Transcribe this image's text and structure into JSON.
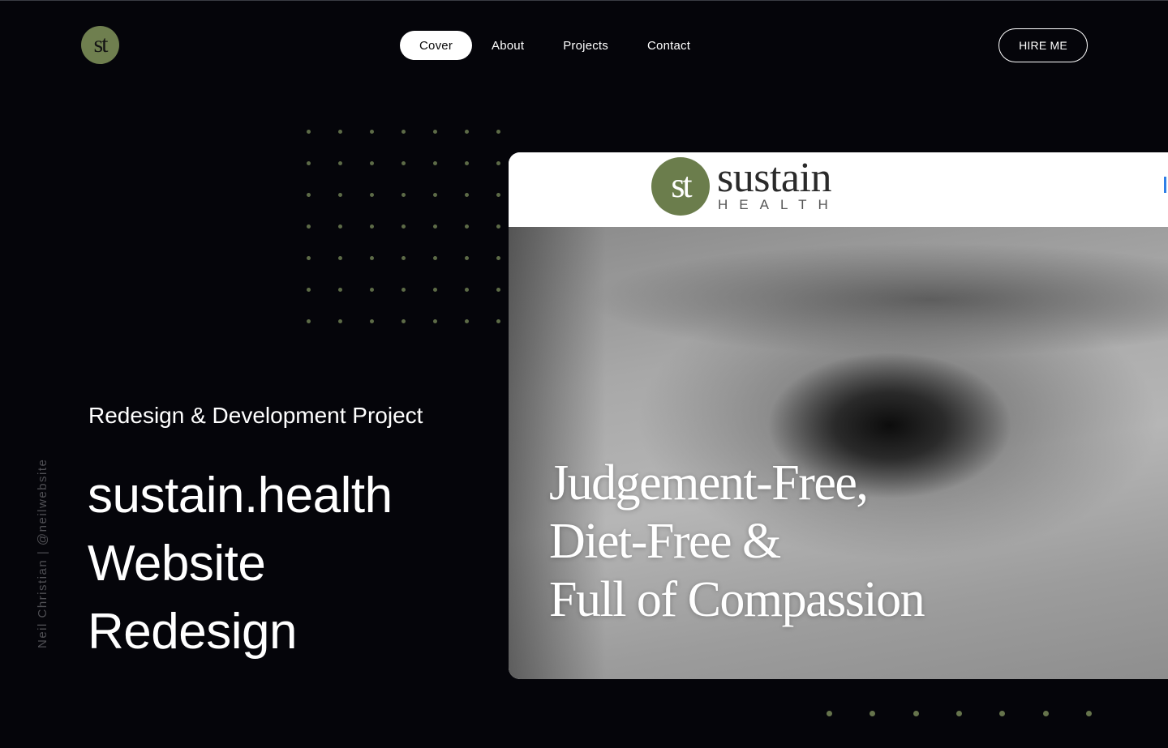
{
  "site": {
    "logo_text": "st"
  },
  "nav": {
    "items": [
      {
        "label": "Cover",
        "active": true
      },
      {
        "label": "About",
        "active": false
      },
      {
        "label": "Projects",
        "active": false
      },
      {
        "label": "Contact",
        "active": false
      }
    ],
    "hire_label": "HIRE ME"
  },
  "side_credit": "Neil Christian | @neilwebsite",
  "hero": {
    "subtitle": "Redesign & Development Project",
    "title_lines": [
      "sustain.health",
      "Website",
      "Redesign"
    ]
  },
  "preview": {
    "brand_badge": "st",
    "brand_name": "sustain",
    "brand_sub": "HEALTH",
    "headline_lines": [
      "Judgement-Free,",
      "Diet-Free &",
      "Full of Compassion"
    ]
  },
  "colors": {
    "background": "#05050a",
    "accent_olive": "#6f7f4f",
    "dot": "#5d6b47",
    "text": "#ffffff"
  }
}
